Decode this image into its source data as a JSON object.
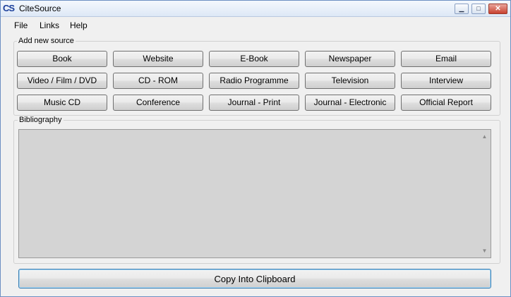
{
  "window": {
    "title": "CiteSource",
    "icon_text": "CS"
  },
  "menu": [
    {
      "label": "File"
    },
    {
      "label": "Links"
    },
    {
      "label": "Help"
    }
  ],
  "add_source": {
    "label": "Add new source",
    "buttons": [
      "Book",
      "Website",
      "E-Book",
      "Newspaper",
      "Email",
      "Video / Film / DVD",
      "CD - ROM",
      "Radio Programme",
      "Television",
      "Interview",
      "Music CD",
      "Conference",
      "Journal - Print",
      "Journal - Electronic",
      "Official Report"
    ]
  },
  "bibliography": {
    "label": "Bibliography",
    "text": ""
  },
  "copy_button": {
    "label": "Copy Into Clipboard"
  },
  "colors": {
    "title_bar": "#dde8f6",
    "window_bg": "#f0f0f0",
    "text_area_bg": "#d4d4d4",
    "icon_text": "#1a3e9a"
  }
}
